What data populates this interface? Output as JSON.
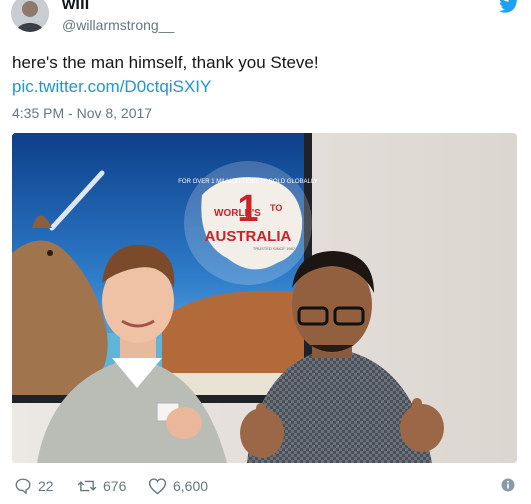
{
  "author": {
    "display_name": "will",
    "handle": "@willarmstrong__"
  },
  "tweet": {
    "text": "here's the man himself, thank you Steve!",
    "link": "pic.twitter.com/D0ctqiSXIY",
    "timestamp": "4:35 PM - Nov 8, 2017"
  },
  "poster": {
    "badge_line1": "WORLD'S",
    "badge_number": "1",
    "badge_to": "TO",
    "badge_word": "AUSTRALIA",
    "arc_text": "FOR OVER 1 MILLION TICKETS SOLD GLOBALLY",
    "since": "TRUSTED SINCE 1987"
  },
  "actions": {
    "replies": "22",
    "retweets": "676",
    "likes": "6,600"
  },
  "icons": {
    "twitter_bird": "twitter-bird-icon",
    "reply": "reply-icon",
    "retweet": "retweet-icon",
    "like": "heart-icon",
    "info": "info-icon"
  },
  "colors": {
    "brand_blue": "#1da1f2",
    "link_blue": "#1b95e0",
    "muted_gray": "#657786",
    "text": "#14171a"
  }
}
